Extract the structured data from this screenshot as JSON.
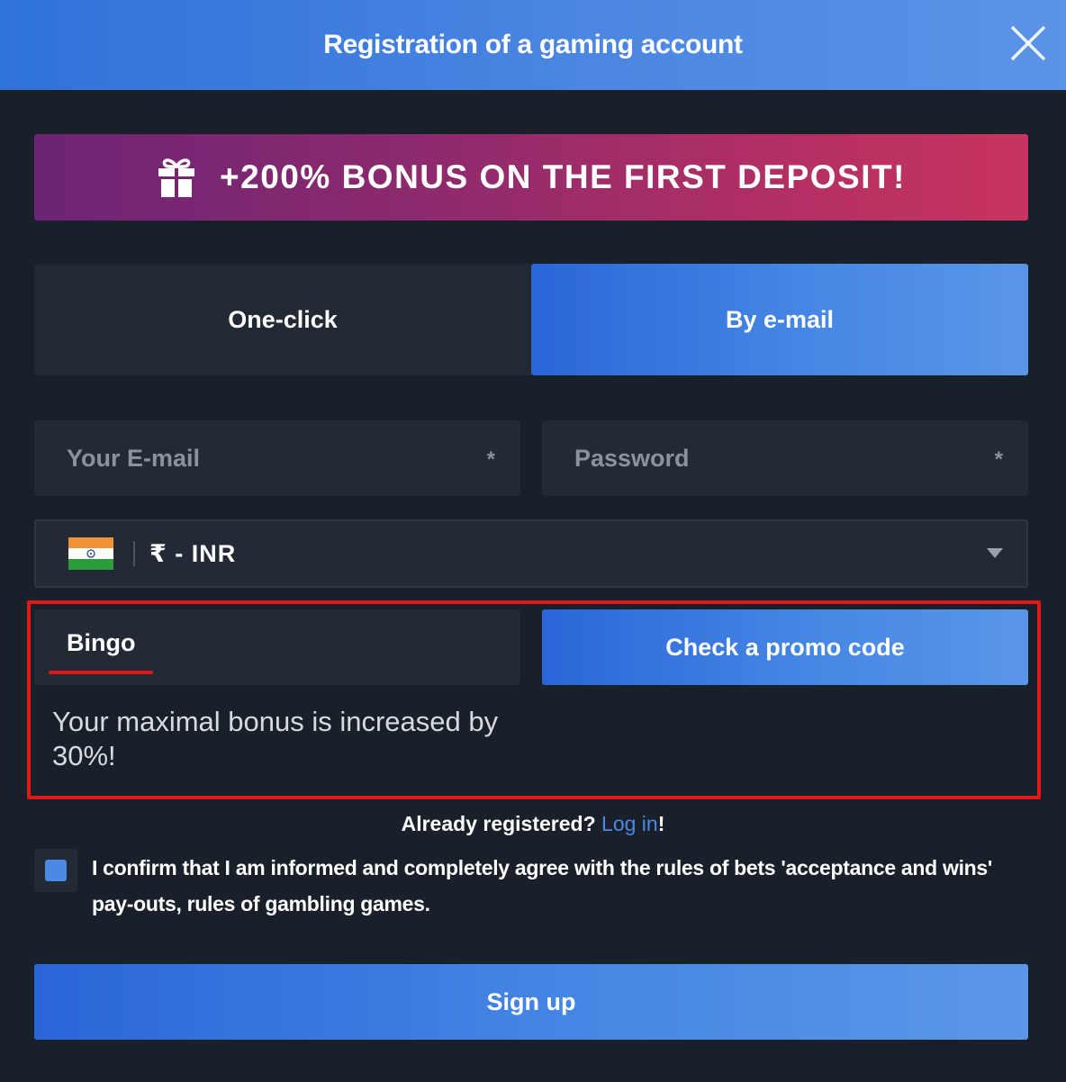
{
  "header": {
    "title": "Registration of a gaming account",
    "close_icon": "close-icon"
  },
  "banner": {
    "icon": "gift-icon",
    "text": "+200% BONUS ON THE FIRST DEPOSIT!"
  },
  "tabs": [
    {
      "label": "One-click",
      "active": false
    },
    {
      "label": "By e-mail",
      "active": true
    }
  ],
  "form": {
    "email": {
      "placeholder": "Your E-mail",
      "value": "",
      "required_mark": "*"
    },
    "password": {
      "placeholder": "Password",
      "value": "",
      "required_mark": "*"
    },
    "currency": {
      "flag": "india-flag-icon",
      "selected": "₹ - INR"
    }
  },
  "promo": {
    "value": "Bingo",
    "check_button": "Check a promo code",
    "message": "Your maximal bonus is increased by 30%!"
  },
  "login_prompt": {
    "text": "Already registered?",
    "link": "Log in",
    "suffix": "!"
  },
  "terms": {
    "checked": true,
    "text": "I confirm that I am informed and completely agree with the rules of bets 'acceptance and wins' pay-outs, rules of gambling games."
  },
  "signup_button": "Sign up",
  "colors": {
    "background": "#1a2029",
    "accent": "#4a86e2",
    "highlight_border": "#e01818",
    "banner_start": "#6c2475",
    "banner_end": "#c8345f"
  }
}
